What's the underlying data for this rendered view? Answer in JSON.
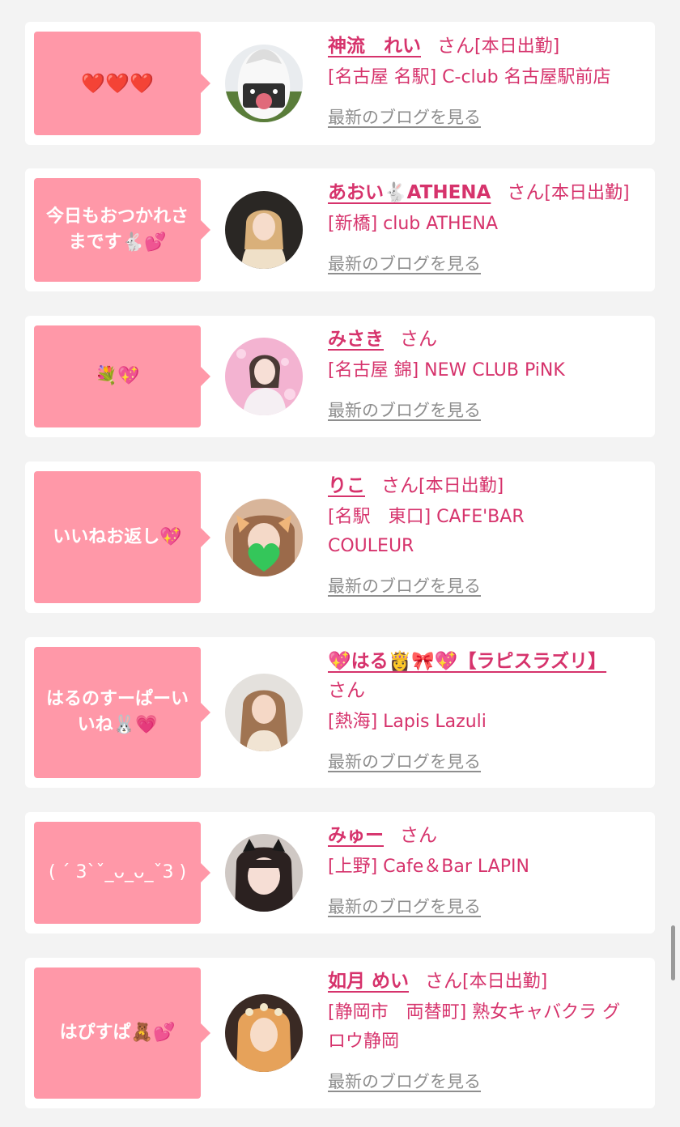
{
  "colors": {
    "bubble": "#ff98a8",
    "accent": "#d6336c",
    "link": "#8e8e8e",
    "card": "#ffffff",
    "background": "#f3f3f3"
  },
  "entries": [
    {
      "bubble": "❤️❤️❤️",
      "name": "神流　れい",
      "san": "さん",
      "shift": "[本日出勤]",
      "shop": "[名古屋 名駅] C-club 名古屋駅前店",
      "blog": "最新のブログを見る",
      "avatar": "onigiri-mask-photo"
    },
    {
      "bubble": "今日もおつかれさ\nまです🐇💕",
      "name": "あおい🐇ATHENA",
      "san": "さん",
      "shift": "[本日出勤]",
      "shop": "[新橋] club ATHENA",
      "blog": "最新のブログを見る",
      "avatar": "blonde-woman-photo"
    },
    {
      "bubble": "💐💖",
      "name": "みさき",
      "san": "さん",
      "shift": "",
      "shop": "[名古屋 錦] NEW CLUB PiNK",
      "blog": "最新のブログを見る",
      "avatar": "pink-background-woman-photo"
    },
    {
      "bubble": "いいねお返し💖",
      "name": "りこ",
      "san": "さん",
      "shift": "[本日出勤]",
      "shop": "[名駅　東口] CAFE'BAR COULEUR",
      "blog": "最新のブログを見る",
      "avatar": "bear-ears-green-heart-photo"
    },
    {
      "bubble": "はるのすーぱーい\nいね🐰💗",
      "name": "💖はる👸🎀💖【ラピスラズリ】",
      "san": "さん",
      "shift": "",
      "shop": "[熱海] Lapis Lazuli",
      "blog": "最新のブログを見る",
      "avatar": "woman-portrait-photo"
    },
    {
      "bubble": "( ´ 3`ˇ_ᴗ_ᴗ_ˇ3 )",
      "name": "みゅー",
      "san": "さん",
      "shift": "",
      "shop": "[上野] Cafe＆Bar LAPIN",
      "blog": "最新のブログを見る",
      "avatar": "bunny-ears-woman-photo"
    },
    {
      "bubble": "はぴすぱ🧸💕",
      "name": "如月 めい",
      "san": "さん",
      "shift": "[本日出勤]",
      "shop": "[静岡市　両替町] 熟女キャバクラ グロウ静岡",
      "blog": "最新のブログを見る",
      "avatar": "orange-hair-woman-photo"
    }
  ]
}
